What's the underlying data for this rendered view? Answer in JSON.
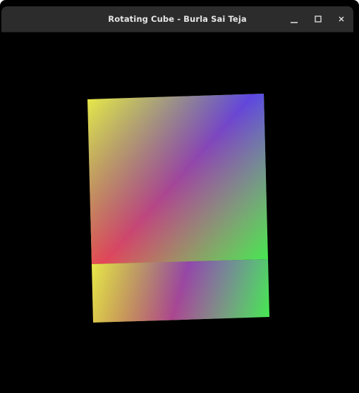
{
  "window": {
    "title": "Rotating Cube - Burla Sai Teja",
    "controls": [
      {
        "name": "minimize",
        "icon": "minimize-icon"
      },
      {
        "name": "maximize",
        "icon": "maximize-icon"
      },
      {
        "name": "close",
        "icon": "close-icon"
      }
    ]
  },
  "scene": {
    "object": "cube",
    "background": "#000000",
    "vertex_colors": {
      "yellow": "#e8e84a",
      "blue": "#5646e8",
      "red": "#e84652",
      "green": "#46e852"
    }
  }
}
